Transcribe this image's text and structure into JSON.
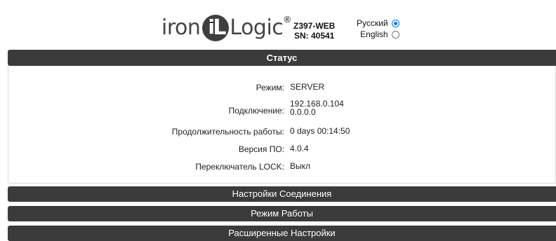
{
  "header": {
    "logo_text_left": "iron",
    "logo_i": "i",
    "logo_L": "L",
    "logo_text_right": "Logic",
    "logo_reg": "®",
    "device_model": "Z397-WEB",
    "device_sn": "SN: 40541"
  },
  "language": {
    "options": [
      {
        "label": "Русский",
        "checked": true
      },
      {
        "label": "English",
        "checked": false
      }
    ]
  },
  "status": {
    "title": "Статус",
    "rows": [
      {
        "label": "Режим:",
        "value": "SERVER"
      },
      {
        "label": "Подключение:",
        "value": "192.168.0.104",
        "value2": "0.0.0.0"
      },
      {
        "label": "Продолжительность работы:",
        "value": "0 days 00:14:50"
      },
      {
        "label": "Версия ПО:",
        "value": "4.0.4"
      },
      {
        "label": "Переключатель LOCK:",
        "value": "Выкл"
      }
    ]
  },
  "sections": [
    {
      "label": "Настройки Соединения"
    },
    {
      "label": "Режим Работы"
    },
    {
      "label": "Расширенные Настройки"
    }
  ],
  "colors": {
    "bar_bg": "#3b3b3b",
    "radio_accent": "#0075ff"
  }
}
